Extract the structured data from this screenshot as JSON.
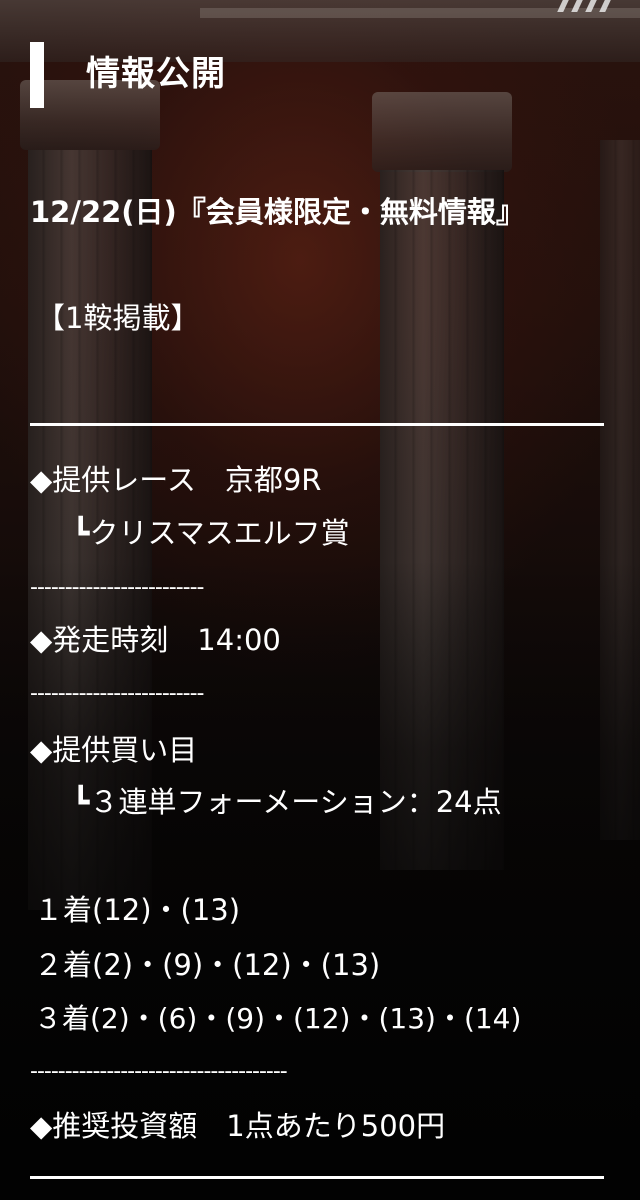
{
  "heading": {
    "title": "情報公開"
  },
  "intro": {
    "date_title": "12/22(日)『会員様限定・無料情報』",
    "count": "【1鞍掲載】"
  },
  "race": {
    "label": "◆提供レース　京都9R",
    "name": "┗クリスマスエルフ賞"
  },
  "divider_short": "-------------------------",
  "start": {
    "label": "◆発走時刻　14:00"
  },
  "bet": {
    "label": "◆提供買い目",
    "type": "┗３連単フォーメーション：24点",
    "first": "１着(12)・(13)",
    "second": "２着(2)・(9)・(12)・(13)",
    "third": "３着(2)・(6)・(9)・(12)・(13)・(14)"
  },
  "divider_long": "-------------------------------------",
  "investment": {
    "label": "◆推奨投資額　1点あたり500円"
  }
}
